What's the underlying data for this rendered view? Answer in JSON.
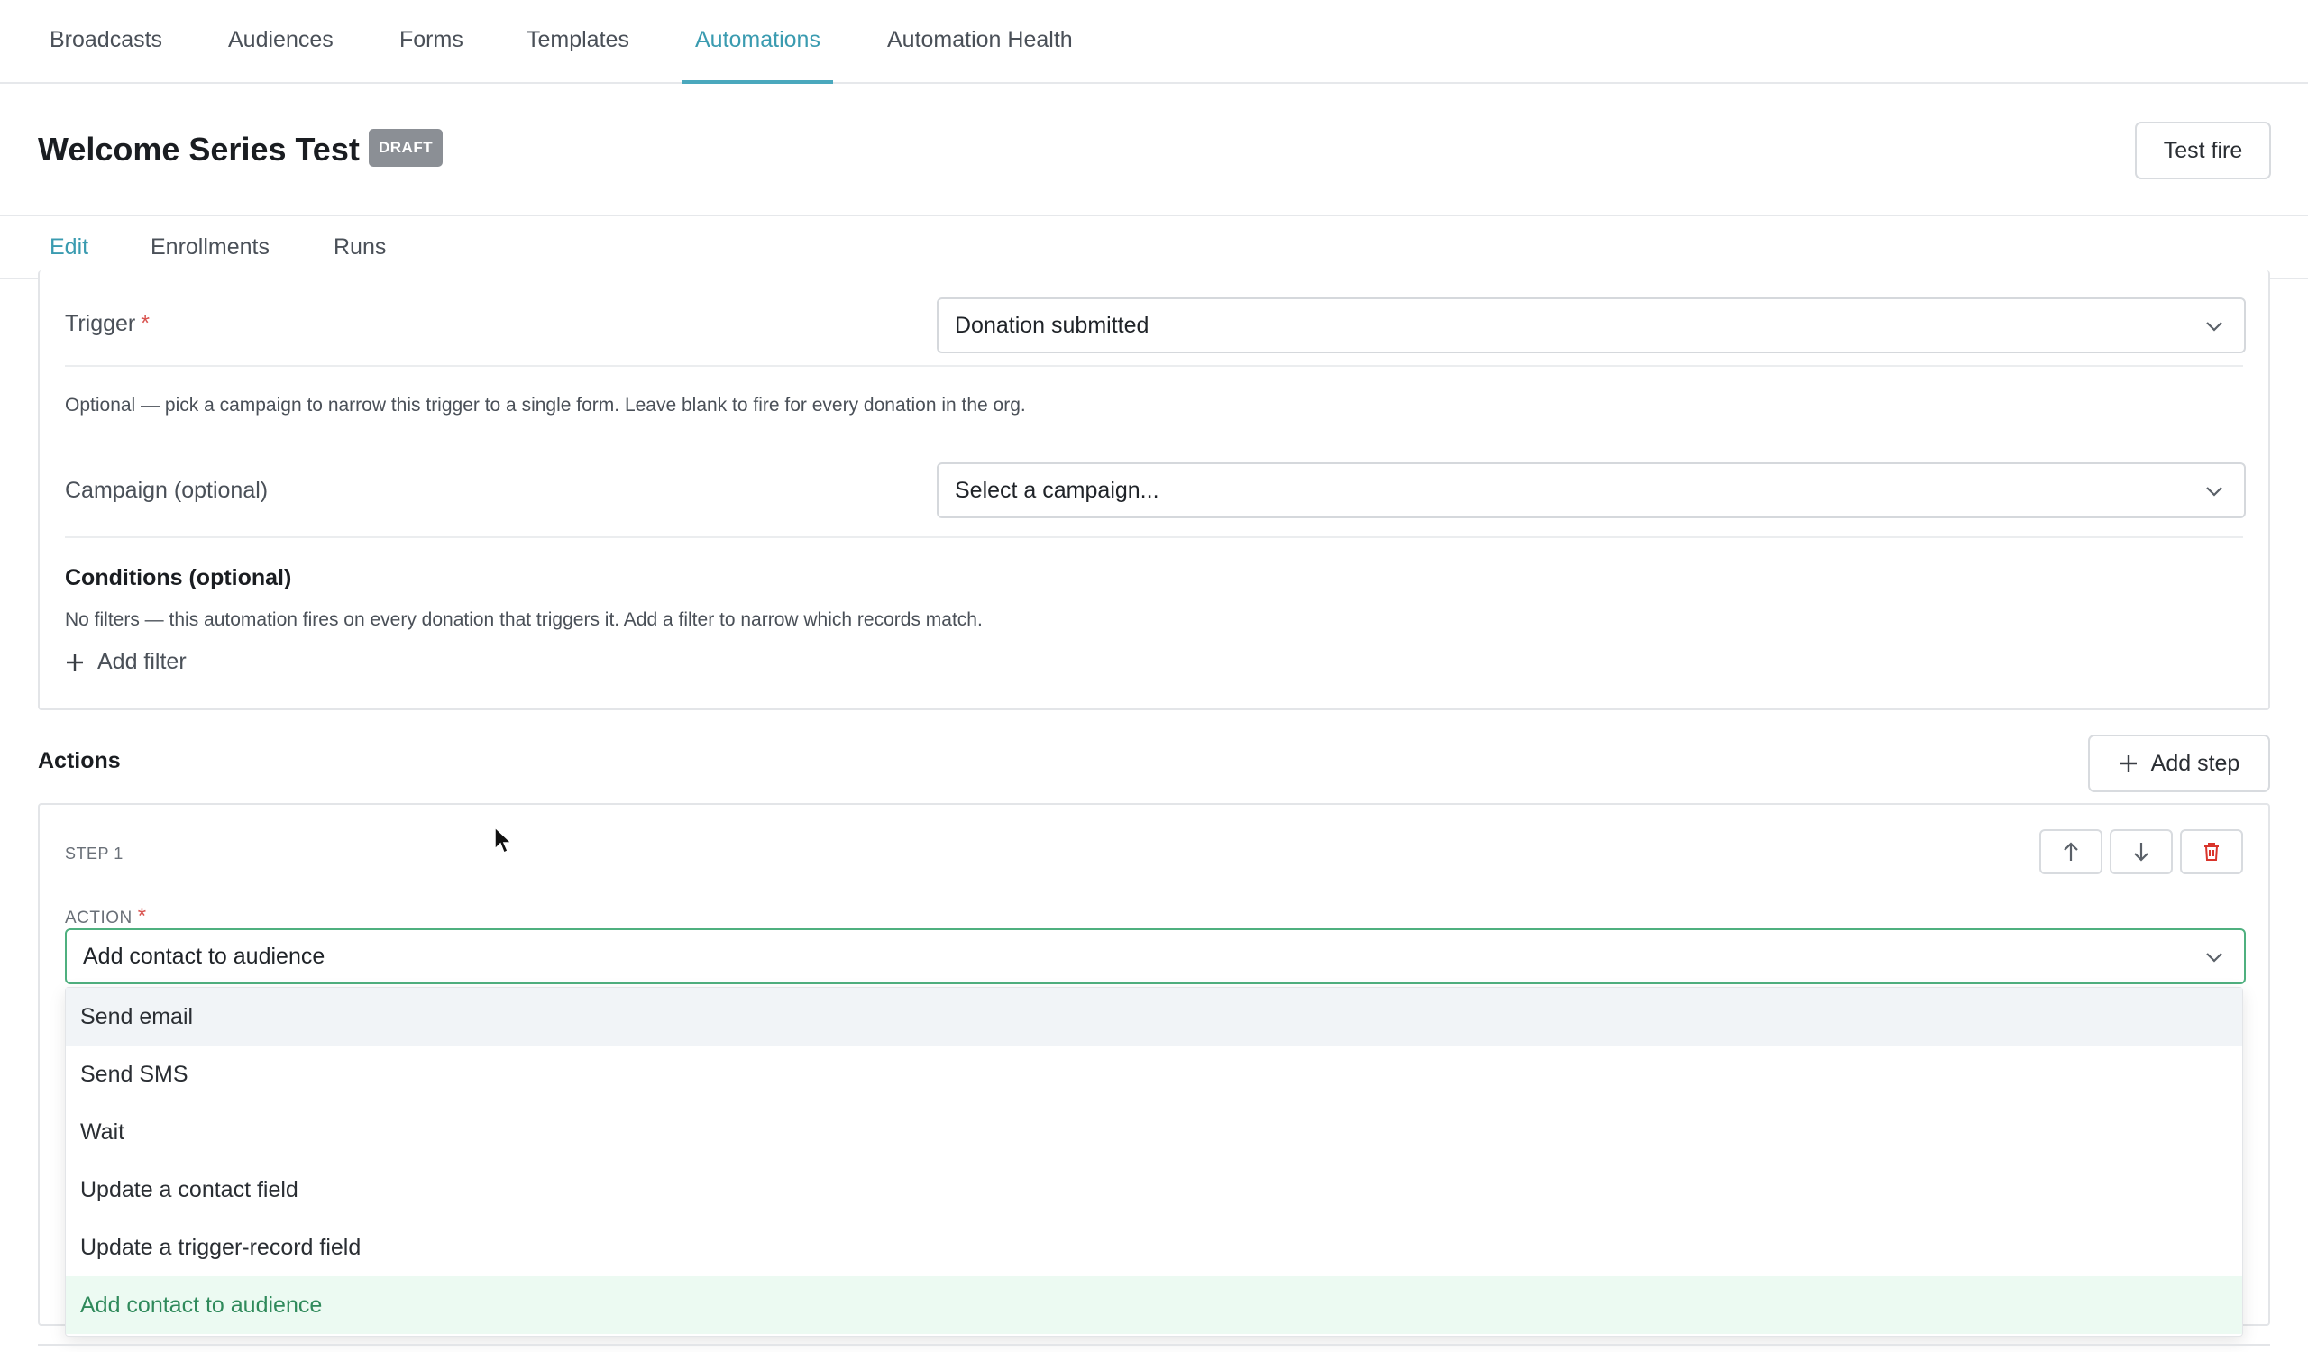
{
  "nav": {
    "tabs": [
      {
        "label": "Broadcasts"
      },
      {
        "label": "Audiences"
      },
      {
        "label": "Forms"
      },
      {
        "label": "Templates"
      },
      {
        "label": "Automations"
      },
      {
        "label": "Automation Health"
      }
    ],
    "active": "Automations"
  },
  "header": {
    "title": "Welcome Series Test",
    "badge": "DRAFT",
    "test_fire_label": "Test fire"
  },
  "subtabs": {
    "tabs": [
      {
        "label": "Edit"
      },
      {
        "label": "Enrollments"
      },
      {
        "label": "Runs"
      }
    ],
    "active": "Edit"
  },
  "trigger": {
    "label": "Trigger",
    "required_mark": "*",
    "value": "Donation submitted",
    "help": "Optional — pick a campaign to narrow this trigger to a single form. Leave blank to fire for every donation in the org.",
    "campaign_label": "Campaign (optional)",
    "campaign_placeholder": "Select a campaign...",
    "conditions_title": "Conditions (optional)",
    "conditions_help": "No filters — this automation fires on every donation that triggers it. Add a filter to narrow which records match.",
    "add_filter_label": "Add filter"
  },
  "actions": {
    "title": "Actions",
    "add_step_label": "Add step",
    "step": {
      "label": "STEP 1",
      "action_label": "ACTION",
      "required_mark": "*",
      "value": "Add contact to audience",
      "options": [
        {
          "label": "Send email"
        },
        {
          "label": "Send SMS"
        },
        {
          "label": "Wait"
        },
        {
          "label": "Update a contact field"
        },
        {
          "label": "Update a trigger-record field"
        },
        {
          "label": "Add contact to audience"
        }
      ]
    }
  },
  "colors": {
    "accent": "#3a9bb0",
    "selected_option_bg": "#ecfaf2",
    "selected_option_text": "#2f8a5b",
    "delete_red": "#d9342b",
    "required_red": "#d9534f"
  }
}
